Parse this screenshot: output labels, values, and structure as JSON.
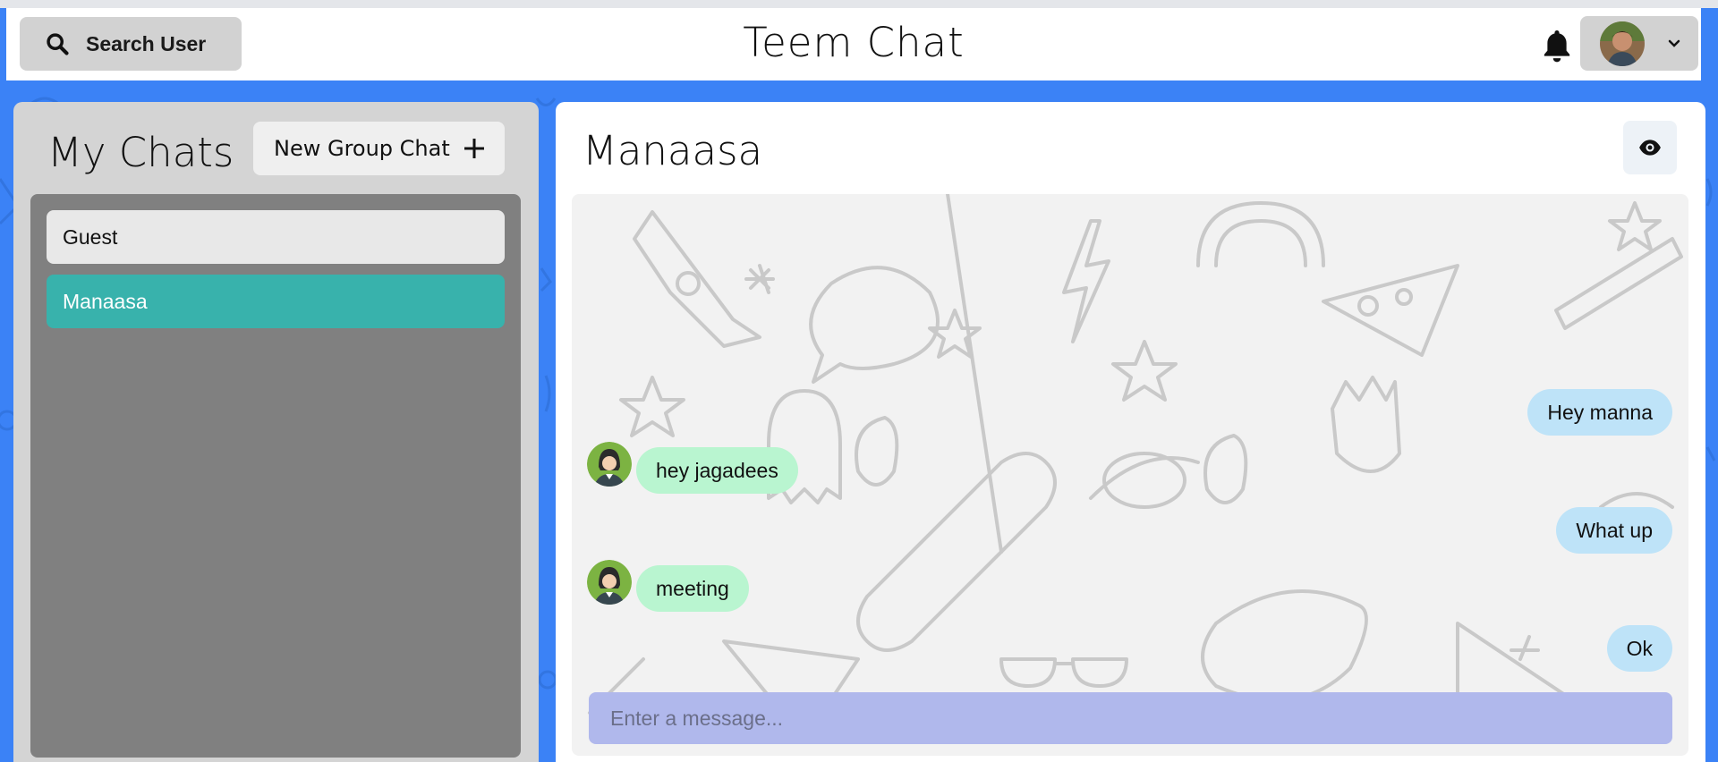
{
  "header": {
    "search_label": "Search User",
    "app_title": "Teem Chat",
    "icons": {
      "search": "search-icon",
      "bell": "bell-icon",
      "chevron": "chevron-down-icon"
    }
  },
  "sidebar": {
    "title": "My Chats",
    "new_group_label": "New Group Chat",
    "chats": [
      {
        "name": "Guest",
        "active": false
      },
      {
        "name": "Manaasa",
        "active": true
      }
    ]
  },
  "chat": {
    "title": "Manaasa",
    "messages": [
      {
        "text": "Hey manna",
        "direction": "outgoing"
      },
      {
        "text": "hey jagadees",
        "direction": "incoming"
      },
      {
        "text": "What up",
        "direction": "outgoing"
      },
      {
        "text": "meeting",
        "direction": "incoming"
      },
      {
        "text": "Ok",
        "direction": "outgoing"
      }
    ],
    "input_placeholder": "Enter a message...",
    "input_value": ""
  },
  "colors": {
    "background": "#3b82f6",
    "active_chat": "#38b2ac",
    "outgoing_bubble": "#bee3f8",
    "incoming_bubble": "#b9f5d0",
    "input_bg": "#b0b8ec"
  }
}
